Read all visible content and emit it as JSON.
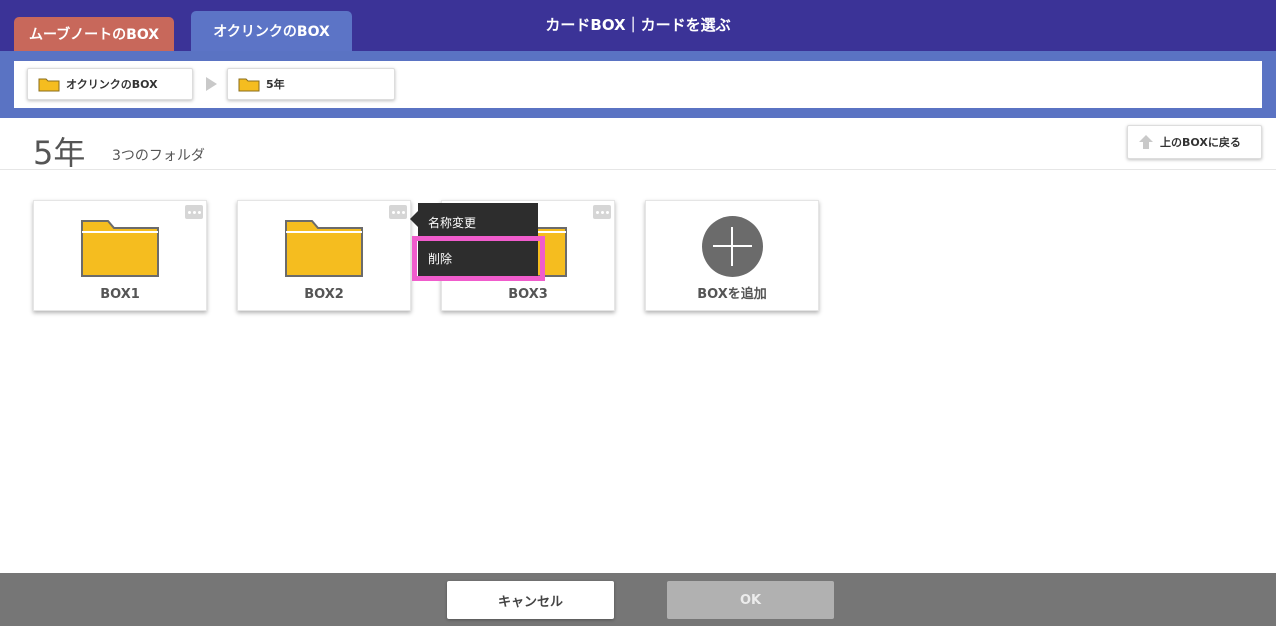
{
  "header": {
    "tabs": [
      {
        "label": "ムーブノートのBOX"
      },
      {
        "label": "オクリンクのBOX"
      }
    ],
    "title": "カードBOX｜カードを選ぶ"
  },
  "breadcrumb": [
    {
      "label": "オクリンクのBOX"
    },
    {
      "label": "5年"
    }
  ],
  "page": {
    "title": "5年",
    "folder_count": "3つのフォルダ",
    "up_button": "上のBOXに戻る"
  },
  "cards": [
    {
      "label": "BOX1"
    },
    {
      "label": "BOX2"
    },
    {
      "label": "BOX3"
    },
    {
      "label": "BOXを追加"
    }
  ],
  "context_menu": {
    "rename": "名称変更",
    "delete": "削除"
  },
  "footer": {
    "cancel": "キャンセル",
    "ok": "OK"
  },
  "colors": {
    "header_bg": "#3b3397",
    "tab_move": "#c8685b",
    "tab_ok": "#5c74c6",
    "folder": "#f5bd1f",
    "highlight": "#f05ccc"
  }
}
